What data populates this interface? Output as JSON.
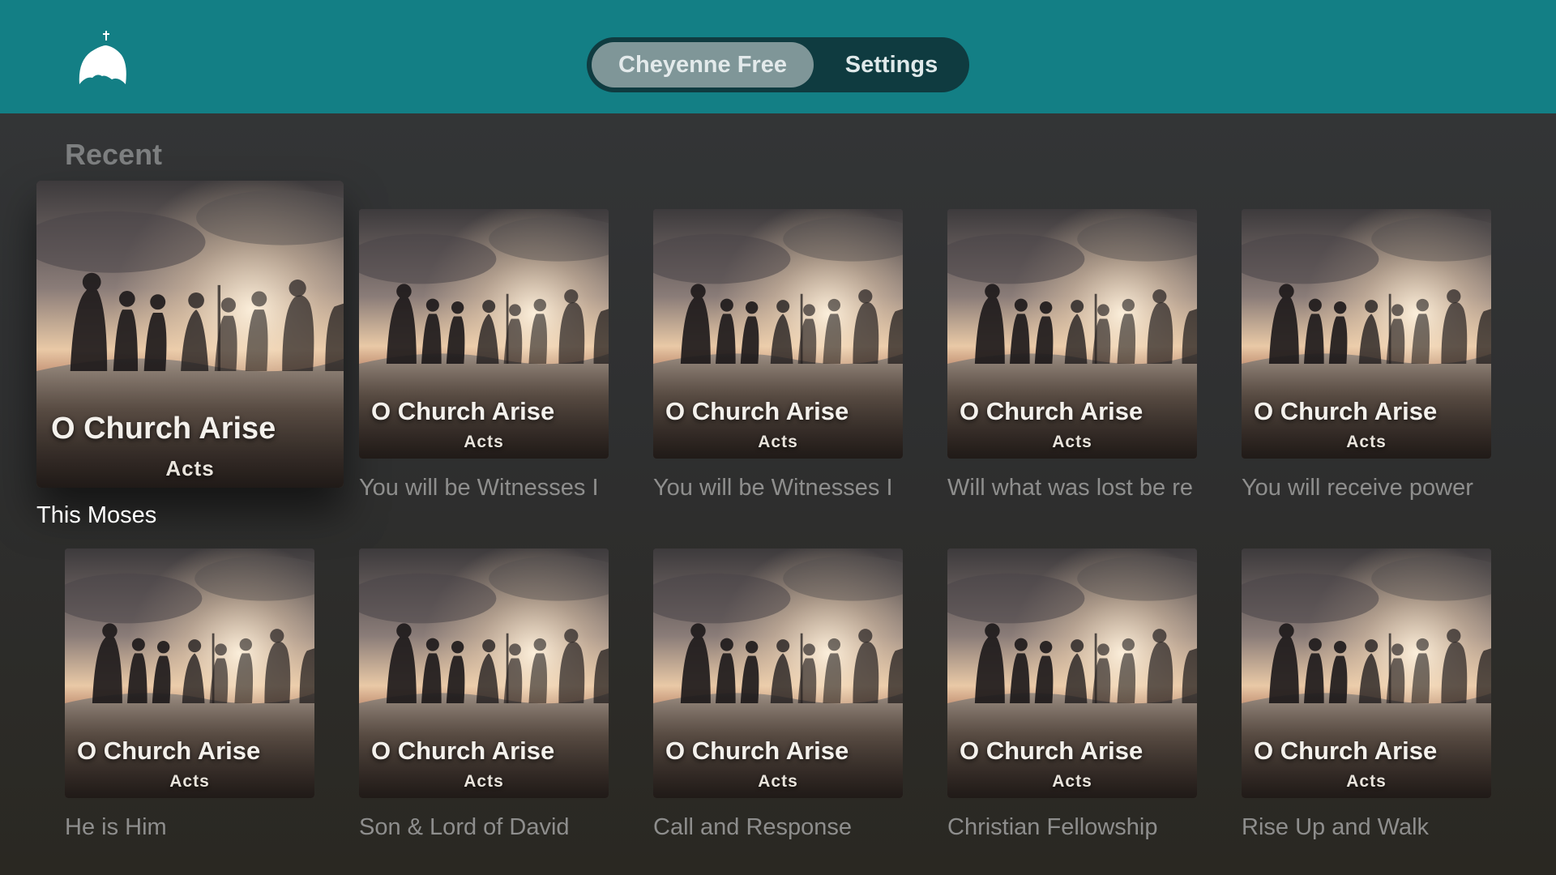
{
  "header": {
    "tabs": [
      {
        "label": "Cheyenne Free",
        "active": true
      },
      {
        "label": "Settings",
        "active": false
      }
    ],
    "logo_icon": "church-dome-icon",
    "bar_color": "#137f85"
  },
  "section": {
    "title": "Recent"
  },
  "cards": [
    {
      "art_title": "O Church Arise",
      "art_subtitle": "Acts",
      "caption": "This Moses",
      "focused": true
    },
    {
      "art_title": "O Church Arise",
      "art_subtitle": "Acts",
      "caption": "You will be Witnesses I",
      "focused": false
    },
    {
      "art_title": "O Church Arise",
      "art_subtitle": "Acts",
      "caption": "You will be Witnesses I",
      "focused": false
    },
    {
      "art_title": "O Church Arise",
      "art_subtitle": "Acts",
      "caption": "Will what was lost be re",
      "focused": false
    },
    {
      "art_title": "O Church Arise",
      "art_subtitle": "Acts",
      "caption": "You will receive power",
      "focused": false
    },
    {
      "art_title": "O Church Arise",
      "art_subtitle": "Acts",
      "caption": "He is Him",
      "focused": false
    },
    {
      "art_title": "O Church Arise",
      "art_subtitle": "Acts",
      "caption": "Son & Lord of David",
      "focused": false
    },
    {
      "art_title": "O Church Arise",
      "art_subtitle": "Acts",
      "caption": "Call and Response",
      "focused": false
    },
    {
      "art_title": "O Church Arise",
      "art_subtitle": "Acts",
      "caption": "Christian Fellowship",
      "focused": false
    },
    {
      "art_title": "O Church Arise",
      "art_subtitle": "Acts",
      "caption": "Rise Up and Walk",
      "focused": false
    }
  ]
}
